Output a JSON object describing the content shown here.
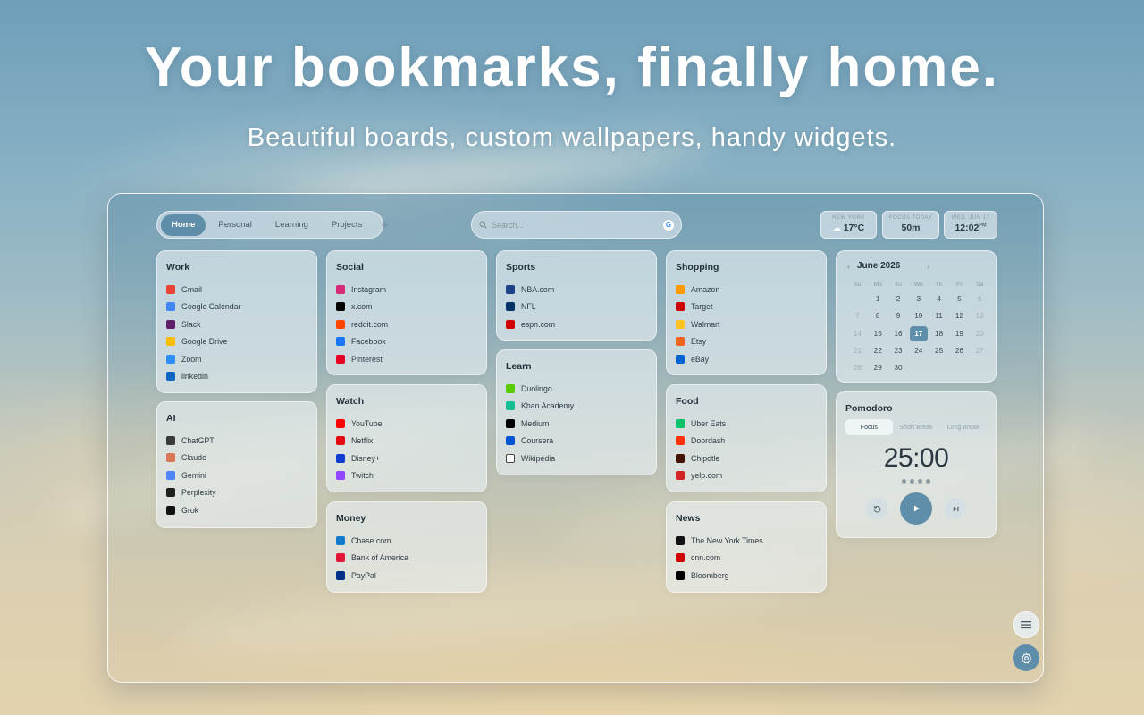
{
  "hero": {
    "title": "Your bookmarks, finally home.",
    "subtitle": "Beautiful boards, custom wallpapers, handy widgets."
  },
  "tabs": [
    {
      "label": "Home",
      "active": true
    },
    {
      "label": "Personal",
      "active": false
    },
    {
      "label": "Learning",
      "active": false
    },
    {
      "label": "Projects",
      "active": false
    }
  ],
  "add_tab": "+",
  "search": {
    "placeholder": "Search...",
    "engine_icon": "google-icon"
  },
  "pills": {
    "weather": {
      "caption": "NEW YORK",
      "value": "17°C",
      "icon": "cloud-icon"
    },
    "focus": {
      "caption": "FOCUS TODAY",
      "value": "50m"
    },
    "clock": {
      "caption": "WED, JUN 17",
      "value": "12:02",
      "suffix": "PM"
    }
  },
  "boards": {
    "work": {
      "title": "Work",
      "links": [
        {
          "label": "Gmail",
          "icon": "gmail-icon",
          "color": "#ea4335"
        },
        {
          "label": "Google Calendar",
          "icon": "google-calendar-icon",
          "color": "#4285f4"
        },
        {
          "label": "Slack",
          "icon": "slack-icon",
          "color": "#611f69"
        },
        {
          "label": "Google Drive",
          "icon": "google-drive-icon",
          "color": "#fbbc04"
        },
        {
          "label": "Zoom",
          "icon": "zoom-icon",
          "color": "#2d8cff"
        },
        {
          "label": "linkedin",
          "icon": "linkedin-icon",
          "color": "#0a66c2"
        }
      ]
    },
    "ai": {
      "title": "AI",
      "links": [
        {
          "label": "ChatGPT",
          "icon": "chatgpt-icon",
          "color": "#3a3a3a"
        },
        {
          "label": "Claude",
          "icon": "claude-icon",
          "color": "#d97757"
        },
        {
          "label": "Gemini",
          "icon": "gemini-icon",
          "color": "#4f86f7"
        },
        {
          "label": "Perplexity",
          "icon": "perplexity-icon",
          "color": "#1f1f1f"
        },
        {
          "label": "Grok",
          "icon": "grok-icon",
          "color": "#111111"
        }
      ]
    },
    "social": {
      "title": "Social",
      "links": [
        {
          "label": "Instagram",
          "icon": "instagram-icon",
          "color": "#d62976"
        },
        {
          "label": "x.com",
          "icon": "x-icon",
          "color": "#000000"
        },
        {
          "label": "reddit.com",
          "icon": "reddit-icon",
          "color": "#ff4500"
        },
        {
          "label": "Facebook",
          "icon": "facebook-icon",
          "color": "#1877f2"
        },
        {
          "label": "Pinterest",
          "icon": "pinterest-icon",
          "color": "#e60023"
        }
      ]
    },
    "watch": {
      "title": "Watch",
      "links": [
        {
          "label": "YouTube",
          "icon": "youtube-icon",
          "color": "#ff0000"
        },
        {
          "label": "Netflix",
          "icon": "netflix-icon",
          "color": "#e50914"
        },
        {
          "label": "Disney+",
          "icon": "disney-plus-icon",
          "color": "#113ccf"
        },
        {
          "label": "Twitch",
          "icon": "twitch-icon",
          "color": "#9146ff"
        }
      ]
    },
    "money": {
      "title": "Money",
      "links": [
        {
          "label": "Chase.com",
          "icon": "chase-icon",
          "color": "#117aca"
        },
        {
          "label": "Bank of America",
          "icon": "bank-of-america-icon",
          "color": "#e31837"
        },
        {
          "label": "PayPal",
          "icon": "paypal-icon",
          "color": "#003087"
        }
      ]
    },
    "sports": {
      "title": "Sports",
      "links": [
        {
          "label": "NBA.com",
          "icon": "nba-icon",
          "color": "#1d428a"
        },
        {
          "label": "NFL",
          "icon": "nfl-icon",
          "color": "#013369"
        },
        {
          "label": "espn.com",
          "icon": "espn-icon",
          "color": "#d00000"
        }
      ]
    },
    "learn": {
      "title": "Learn",
      "links": [
        {
          "label": "Duolingo",
          "icon": "duolingo-icon",
          "color": "#58cc02"
        },
        {
          "label": "Khan Academy",
          "icon": "khan-academy-icon",
          "color": "#14bf96"
        },
        {
          "label": "Medium",
          "icon": "medium-icon",
          "color": "#000000"
        },
        {
          "label": "Coursera",
          "icon": "coursera-icon",
          "color": "#0056d2"
        },
        {
          "label": "Wikipedia",
          "icon": "wikipedia-icon",
          "color": "#ffffff"
        }
      ]
    },
    "shopping": {
      "title": "Shopping",
      "links": [
        {
          "label": "Amazon",
          "icon": "amazon-icon",
          "color": "#ff9900"
        },
        {
          "label": "Target",
          "icon": "target-icon",
          "color": "#cc0000"
        },
        {
          "label": "Walmart",
          "icon": "walmart-icon",
          "color": "#ffc220"
        },
        {
          "label": "Etsy",
          "icon": "etsy-icon",
          "color": "#f1641e"
        },
        {
          "label": "eBay",
          "icon": "ebay-icon",
          "color": "#0064d2"
        }
      ]
    },
    "food": {
      "title": "Food",
      "links": [
        {
          "label": "Uber Eats",
          "icon": "uber-eats-icon",
          "color": "#06c167"
        },
        {
          "label": "Doordash",
          "icon": "doordash-icon",
          "color": "#ff3008"
        },
        {
          "label": "Chipotle",
          "icon": "chipotle-icon",
          "color": "#451400"
        },
        {
          "label": "yelp.com",
          "icon": "yelp-icon",
          "color": "#d32323"
        }
      ]
    },
    "news": {
      "title": "News",
      "links": [
        {
          "label": "The New York Times",
          "icon": "nyt-icon",
          "color": "#111111"
        },
        {
          "label": "cnn.com",
          "icon": "cnn-icon",
          "color": "#cc0000"
        },
        {
          "label": "Bloomberg",
          "icon": "bloomberg-icon",
          "color": "#000000"
        }
      ]
    }
  },
  "calendar": {
    "month": "June 2026",
    "prev": "‹",
    "next": "›",
    "weekdays": [
      "Su",
      "Mo",
      "Tu",
      "We",
      "Th",
      "Fr",
      "Sa"
    ],
    "days": [
      "",
      "1",
      "2",
      "3",
      "4",
      "5",
      "6",
      "7",
      "8",
      "9",
      "10",
      "11",
      "12",
      "13",
      "14",
      "15",
      "16",
      "17",
      "18",
      "19",
      "20",
      "21",
      "22",
      "23",
      "24",
      "25",
      "26",
      "27",
      "28",
      "29",
      "30"
    ],
    "today": "17"
  },
  "pomodoro": {
    "title": "Pomodoro",
    "modes": [
      "Focus",
      "Short Break",
      "Long Break"
    ],
    "active_mode": "Focus",
    "time": "25:00",
    "sessions": 4
  },
  "colors": {
    "accent": "#5e8ea9"
  }
}
